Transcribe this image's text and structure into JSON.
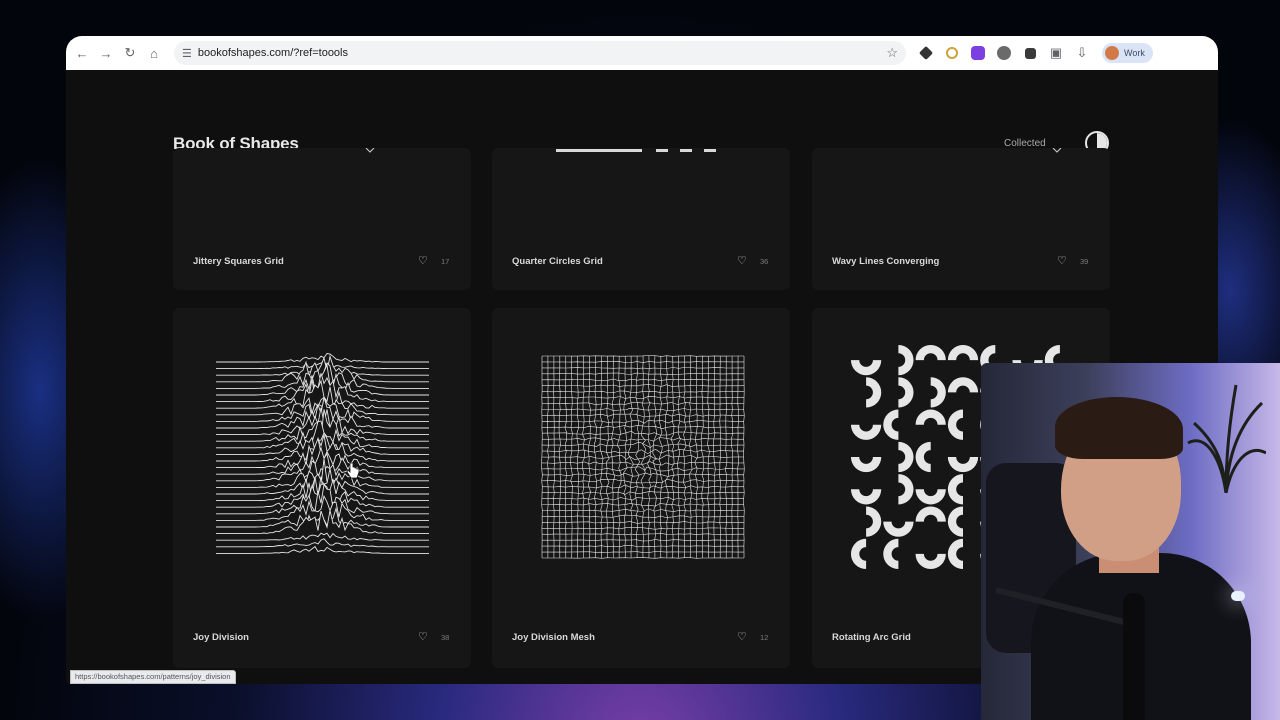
{
  "browser": {
    "url": "bookofshapes.com/?ref=toools",
    "profile_label": "Work",
    "status_url": "https://bookofshapes.com/patterns/joy_division"
  },
  "site": {
    "brand": "Book of Shapes",
    "collected_label": "Collected",
    "theme_toggle_icon": "half-circle-icon"
  },
  "cards_top": [
    {
      "title": "Jittery Squares Grid",
      "likes": "17"
    },
    {
      "title": "Quarter Circles Grid",
      "likes": "36"
    },
    {
      "title": "Wavy Lines Converging",
      "likes": "39"
    }
  ],
  "cards_main": [
    {
      "title": "Joy Division",
      "likes": "38"
    },
    {
      "title": "Joy Division Mesh",
      "likes": "12"
    },
    {
      "title": "Rotating Arc Grid",
      "likes": ""
    }
  ],
  "icons": {
    "back": "arrow-left-icon",
    "forward": "arrow-right-icon",
    "reload": "reload-icon",
    "home": "home-icon",
    "site_info": "tune-icon",
    "bookmark": "star-icon",
    "download": "download-icon",
    "like": "heart-icon"
  },
  "colors": {
    "page_bg": "#0f0f10",
    "card_bg": "#161617",
    "pattern_stroke": "#e6e6e6"
  }
}
